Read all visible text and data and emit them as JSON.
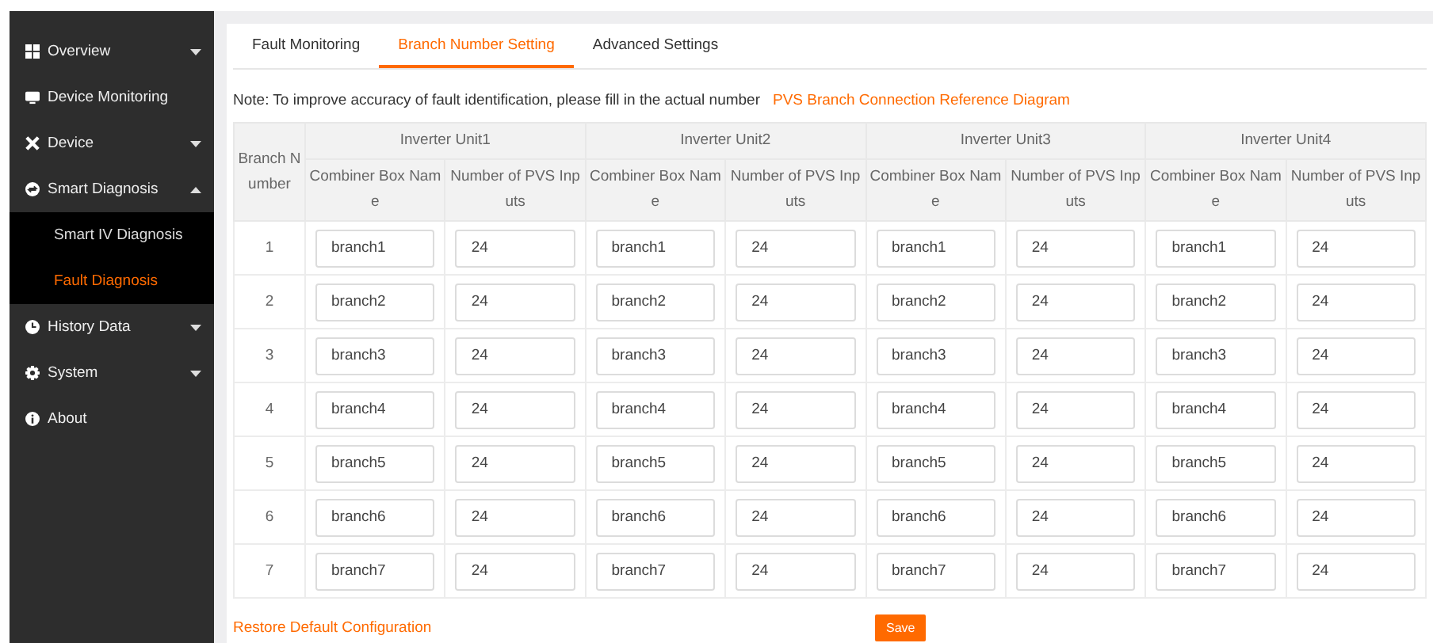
{
  "sidebar": {
    "items": [
      {
        "label": "Overview",
        "expanded": false
      },
      {
        "label": "Device Monitoring"
      },
      {
        "label": "Device",
        "expanded": false
      },
      {
        "label": "Smart Diagnosis",
        "expanded": true,
        "children": [
          {
            "label": "Smart IV Diagnosis",
            "selected": false
          },
          {
            "label": "Fault Diagnosis",
            "selected": true
          }
        ]
      },
      {
        "label": "History Data",
        "expanded": false
      },
      {
        "label": "System",
        "expanded": false
      },
      {
        "label": "About"
      }
    ]
  },
  "tabs": [
    {
      "label": "Fault Monitoring",
      "selected": false
    },
    {
      "label": "Branch Number Setting",
      "selected": true
    },
    {
      "label": "Advanced Settings",
      "selected": false
    }
  ],
  "note": {
    "text": "Note: To improve accuracy of fault identification, please fill in the actual number",
    "link": "PVS Branch Connection Reference Diagram"
  },
  "table": {
    "row_header": "Branch Number",
    "units": [
      {
        "name": "Inverter Unit1",
        "columns": [
          "Combiner Box Name",
          "Number of PVS Inputs"
        ]
      },
      {
        "name": "Inverter Unit2",
        "columns": [
          "Combiner Box Name",
          "Number of PVS Inputs"
        ]
      },
      {
        "name": "Inverter Unit3",
        "columns": [
          "Combiner Box Name",
          "Number of PVS Inputs"
        ]
      },
      {
        "name": "Inverter Unit4",
        "columns": [
          "Combiner Box Name",
          "Number of PVS Inputs"
        ]
      }
    ],
    "rows": [
      {
        "number": "1",
        "cells": [
          {
            "name": "branch1",
            "inputs": "24"
          },
          {
            "name": "branch1",
            "inputs": "24"
          },
          {
            "name": "branch1",
            "inputs": "24"
          },
          {
            "name": "branch1",
            "inputs": "24"
          }
        ]
      },
      {
        "number": "2",
        "cells": [
          {
            "name": "branch2",
            "inputs": "24"
          },
          {
            "name": "branch2",
            "inputs": "24"
          },
          {
            "name": "branch2",
            "inputs": "24"
          },
          {
            "name": "branch2",
            "inputs": "24"
          }
        ]
      },
      {
        "number": "3",
        "cells": [
          {
            "name": "branch3",
            "inputs": "24"
          },
          {
            "name": "branch3",
            "inputs": "24"
          },
          {
            "name": "branch3",
            "inputs": "24"
          },
          {
            "name": "branch3",
            "inputs": "24"
          }
        ]
      },
      {
        "number": "4",
        "cells": [
          {
            "name": "branch4",
            "inputs": "24"
          },
          {
            "name": "branch4",
            "inputs": "24"
          },
          {
            "name": "branch4",
            "inputs": "24"
          },
          {
            "name": "branch4",
            "inputs": "24"
          }
        ]
      },
      {
        "number": "5",
        "cells": [
          {
            "name": "branch5",
            "inputs": "24"
          },
          {
            "name": "branch5",
            "inputs": "24"
          },
          {
            "name": "branch5",
            "inputs": "24"
          },
          {
            "name": "branch5",
            "inputs": "24"
          }
        ]
      },
      {
        "number": "6",
        "cells": [
          {
            "name": "branch6",
            "inputs": "24"
          },
          {
            "name": "branch6",
            "inputs": "24"
          },
          {
            "name": "branch6",
            "inputs": "24"
          },
          {
            "name": "branch6",
            "inputs": "24"
          }
        ]
      },
      {
        "number": "7",
        "cells": [
          {
            "name": "branch7",
            "inputs": "24"
          },
          {
            "name": "branch7",
            "inputs": "24"
          },
          {
            "name": "branch7",
            "inputs": "24"
          },
          {
            "name": "branch7",
            "inputs": "24"
          }
        ]
      }
    ]
  },
  "footer": {
    "restore": "Restore Default Configuration",
    "save": "Save"
  }
}
